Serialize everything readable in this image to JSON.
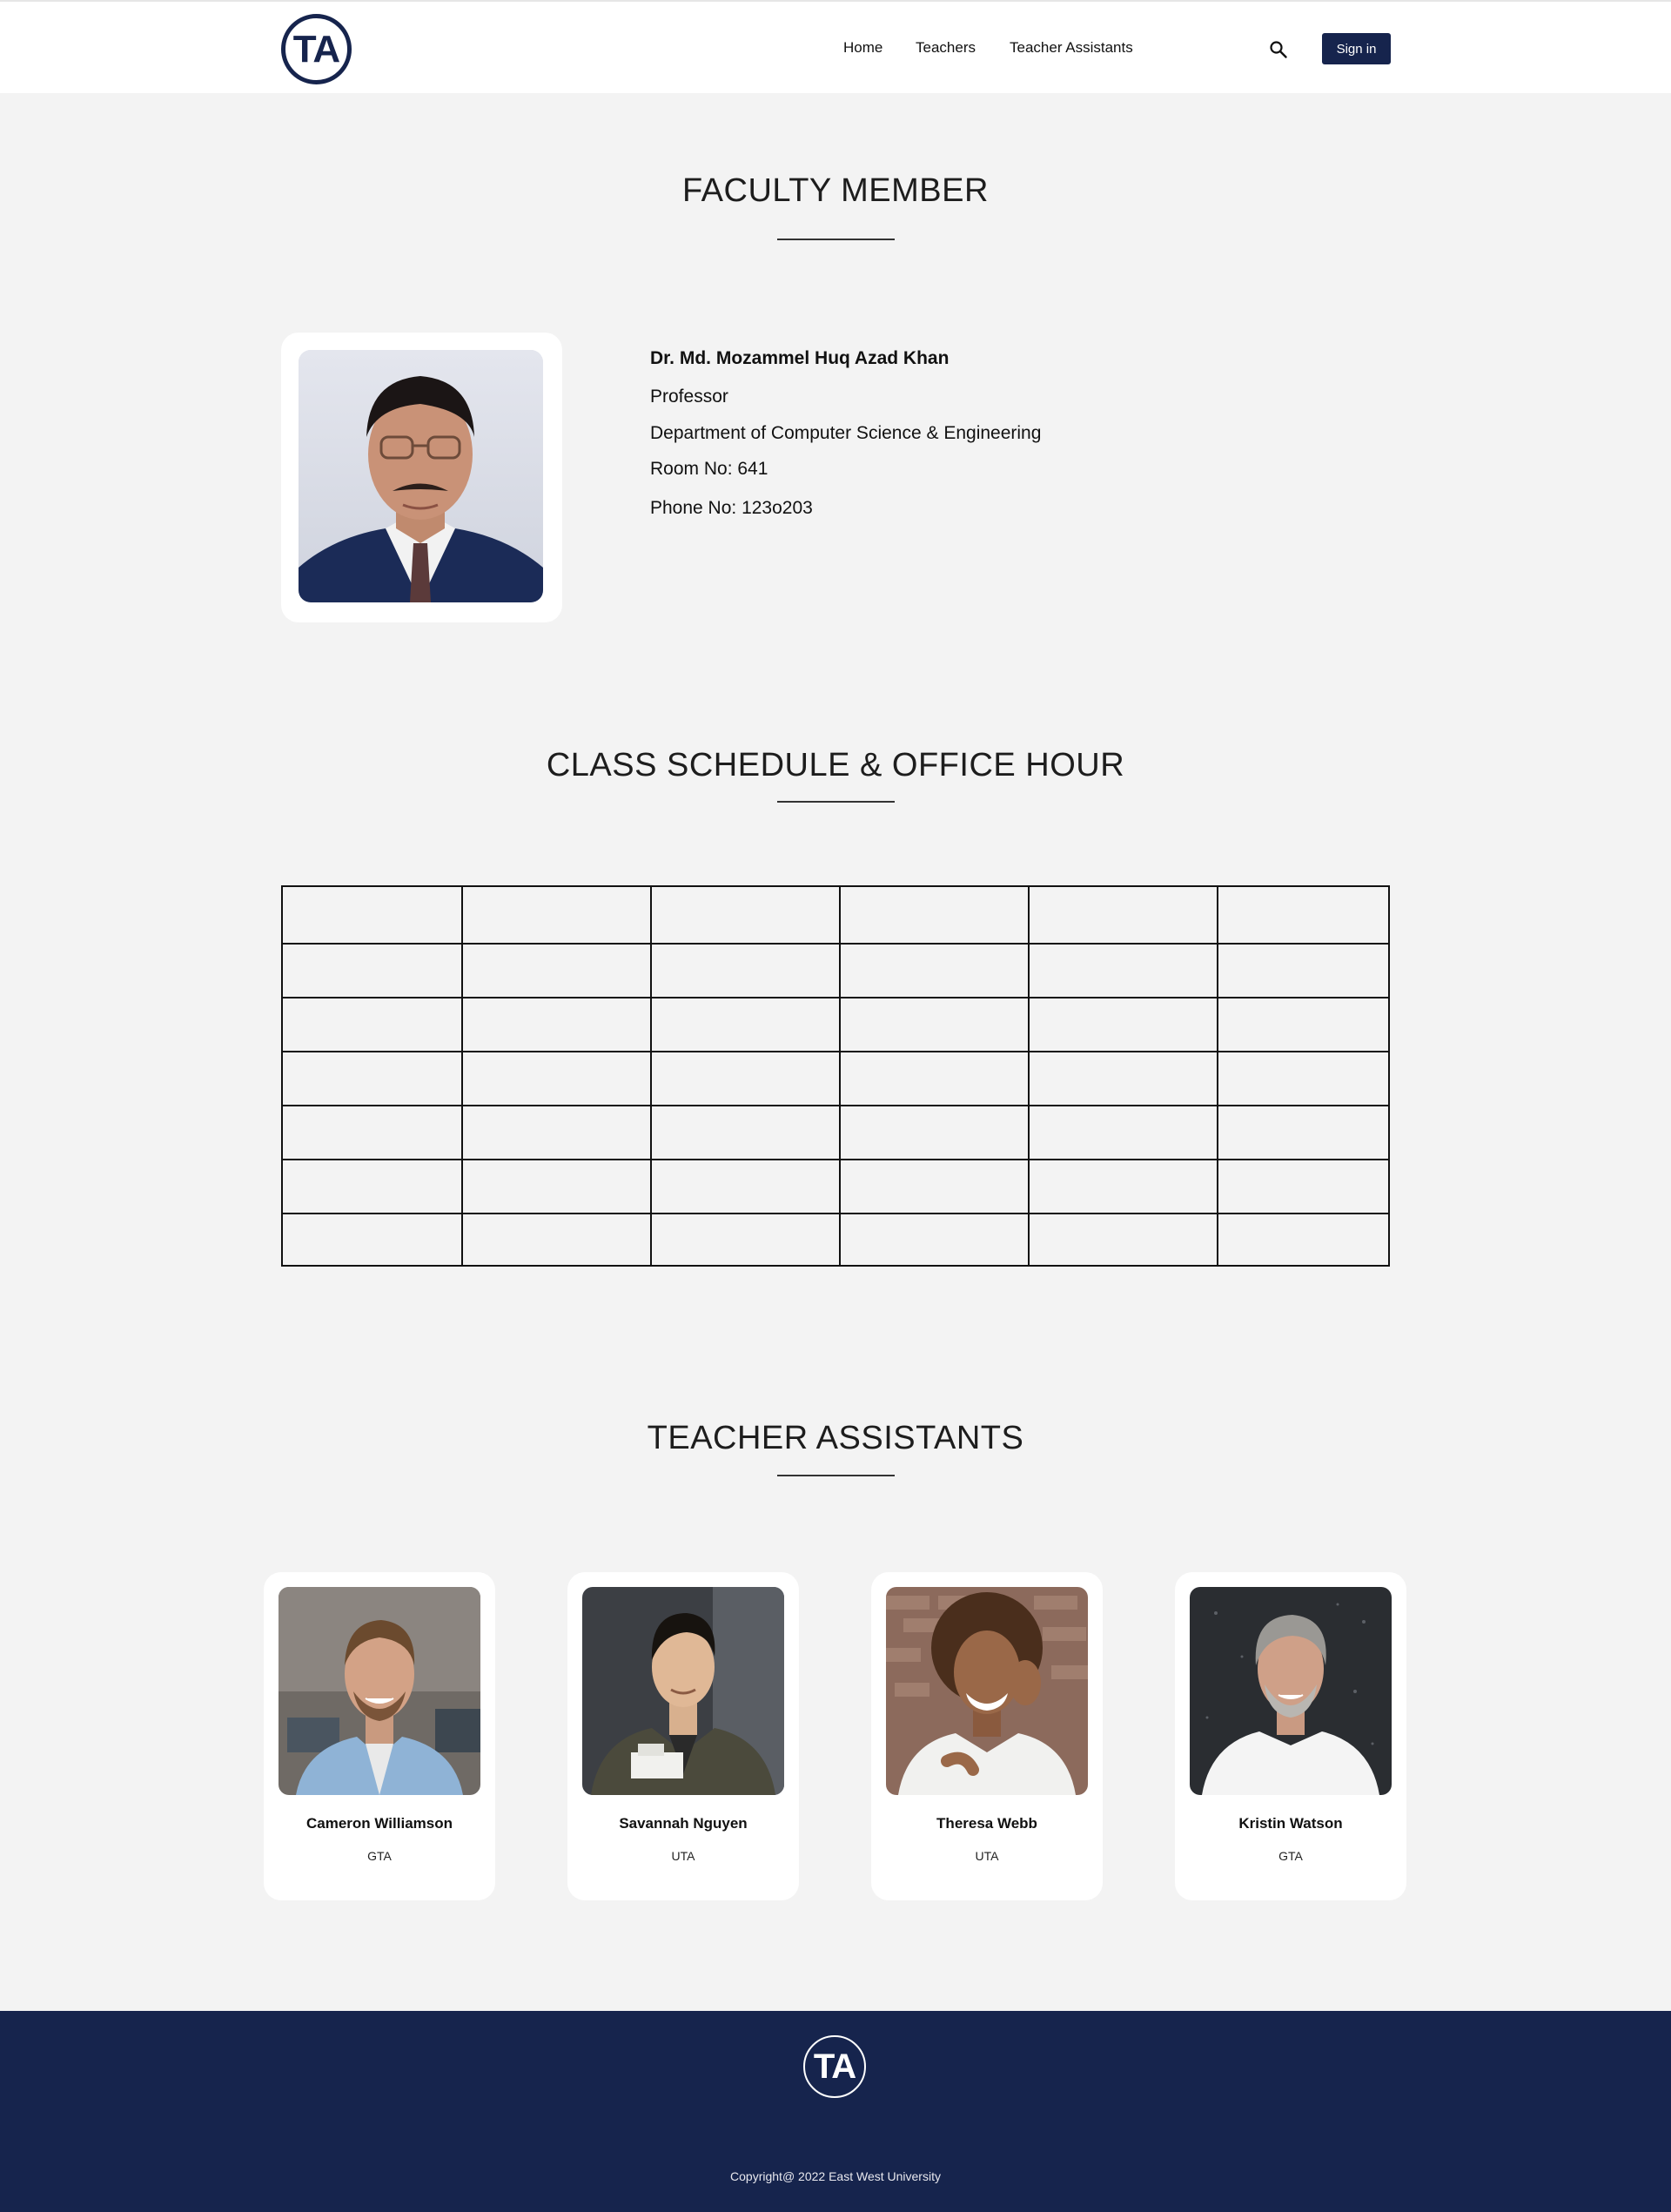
{
  "nav": {
    "logo_text": "TA",
    "links": [
      {
        "label": "Home"
      },
      {
        "label": "Teachers"
      },
      {
        "label": "Teacher Assistants"
      }
    ],
    "search_icon": "search-icon",
    "sign_in_label": "Sign in"
  },
  "faculty": {
    "heading": "FACULTY MEMBER",
    "name": "Dr. Md. Mozammel Huq Azad Khan",
    "title": "Professor",
    "department": "Department of Computer Science & Engineering",
    "room": "Room No: 641",
    "phone": "Phone No: 123o203"
  },
  "schedule": {
    "heading": "CLASS SCHEDULE & OFFICE HOUR",
    "rows": [
      [
        "",
        "",
        "",
        "",
        "",
        ""
      ],
      [
        "",
        "",
        "",
        "",
        "",
        ""
      ],
      [
        "",
        "",
        "",
        "",
        "",
        ""
      ],
      [
        "",
        "",
        "",
        "",
        "",
        ""
      ],
      [
        "",
        "",
        "",
        "",
        "",
        ""
      ],
      [
        "",
        "",
        "",
        "",
        "",
        ""
      ],
      [
        "",
        "",
        "",
        "",
        "",
        ""
      ]
    ]
  },
  "assistants": {
    "heading": "TEACHER ASSISTANTS",
    "items": [
      {
        "name": "Cameron Williamson",
        "role": "GTA"
      },
      {
        "name": "Savannah Nguyen",
        "role": "UTA"
      },
      {
        "name": "Theresa Webb",
        "role": "UTA"
      },
      {
        "name": "Kristin Watson",
        "role": "GTA"
      }
    ]
  },
  "footer": {
    "logo_text": "TA",
    "copyright": "Copyright@ 2022 East West University"
  },
  "colors": {
    "brand_navy": "#16244d",
    "page_bg": "#f3f3f3",
    "card_bg": "#ffffff"
  }
}
